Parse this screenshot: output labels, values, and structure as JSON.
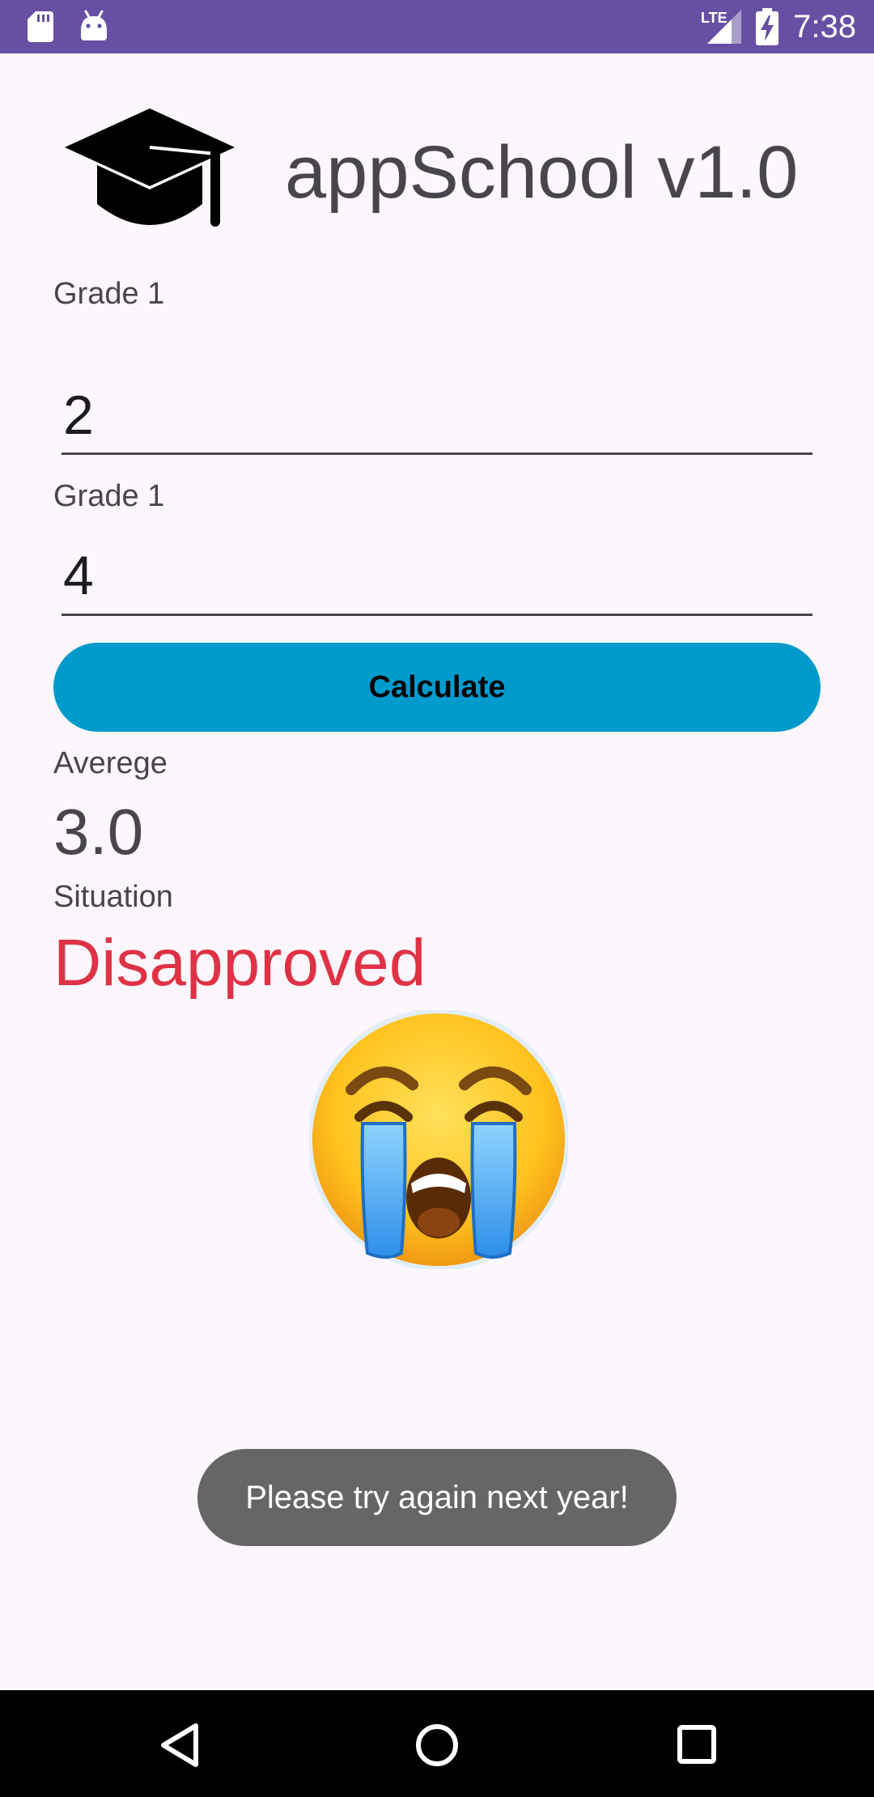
{
  "status_bar": {
    "time": "7:38",
    "network": "LTE",
    "icons": [
      "sd-card-icon",
      "android-icon",
      "lte-signal-icon",
      "battery-charging-icon"
    ]
  },
  "header": {
    "title": "appSchool v1.0",
    "logo_icon": "graduation-cap-icon"
  },
  "form": {
    "grade1": {
      "label": "Grade 1",
      "value": "2"
    },
    "grade2": {
      "label": "Grade 1",
      "value": "4"
    },
    "calculate_label": "Calculate"
  },
  "result": {
    "average_label": "Averege",
    "average_value": "3.0",
    "situation_label": "Situation",
    "situation_value": "Disapproved",
    "emoji_icon": "loudly-crying-face-icon"
  },
  "toast": {
    "message": "Please try again next year!"
  },
  "nav_bar": {
    "icons": [
      "back-icon",
      "home-icon",
      "recents-icon"
    ]
  },
  "colors": {
    "status_bar": "#6750A4",
    "background": "#FDF7FD",
    "button": "#009BCC",
    "situation": "#E03245",
    "toast": "#666666"
  }
}
